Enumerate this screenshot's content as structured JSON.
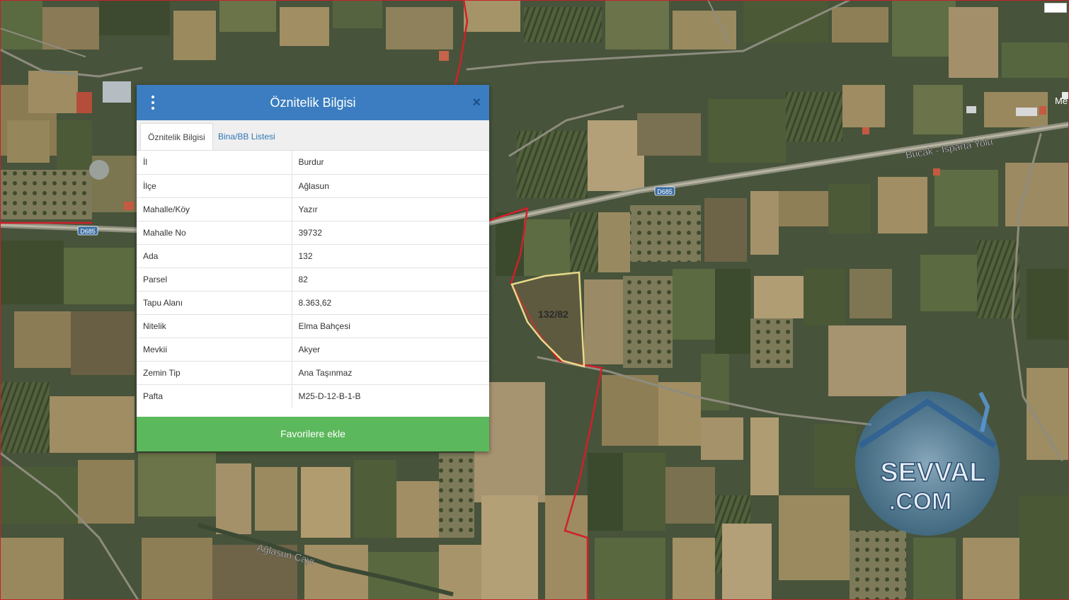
{
  "panel": {
    "title": "Öznitelik Bilgisi",
    "close_label": "×",
    "tabs": [
      {
        "label": "Öznitelik Bilgisi",
        "active": true
      },
      {
        "label": "Bina/BB Listesi",
        "active": false
      }
    ],
    "rows": [
      {
        "key": "İl",
        "value": "Burdur"
      },
      {
        "key": "İlçe",
        "value": "Ağlasun"
      },
      {
        "key": "Mahalle/Köy",
        "value": "Yazır"
      },
      {
        "key": "Mahalle No",
        "value": "39732"
      },
      {
        "key": "Ada",
        "value": "132"
      },
      {
        "key": "Parsel",
        "value": "82"
      },
      {
        "key": "Tapu Alanı",
        "value": "8.363,62"
      },
      {
        "key": "Nitelik",
        "value": "Elma Bahçesi"
      },
      {
        "key": "Mevkii",
        "value": "Akyer"
      },
      {
        "key": "Zemin Tip",
        "value": "Ana Taşınmaz"
      },
      {
        "key": "Pafta",
        "value": "M25-D-12-B-1-B"
      }
    ],
    "favorite_label": "Favorilere ekle"
  },
  "map": {
    "parcel_label": "132/82",
    "road_name": "Bucak - Isparta Yolu",
    "road_badge_1": "D685",
    "road_badge_2": "D685",
    "river_name": "Ağlasun Çayı",
    "edge_label": "Me",
    "watermark_line1": "SEVVAL",
    "watermark_line2": ".COM",
    "colors": {
      "header": "#3b7dc0",
      "favorite": "#5cb85c",
      "boundary": "#d0202a",
      "parcel_outline": "#e8d98a"
    }
  }
}
